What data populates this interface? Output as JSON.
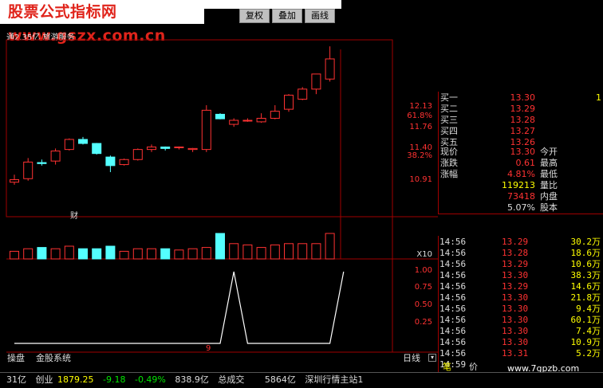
{
  "watermark": "股票公式指标网 www.gszx.com.cn",
  "toolbar": {
    "restore": "复权",
    "overlay": "叠加",
    "draw": "画线"
  },
  "stock_info": "通2.35亿 旅游服务",
  "right_axis": {
    "main": [
      "12.13",
      "61.8%",
      "11.76",
      "11.40",
      "38.2%",
      "10.91"
    ],
    "vol_label": "X10",
    "ind": [
      "1.00",
      "0.75",
      "0.50",
      "0.25"
    ]
  },
  "fin_label": "财",
  "marker_9": "9",
  "quote": {
    "bids": [
      {
        "label": "买一",
        "price": "13.30",
        "vol": "1"
      },
      {
        "label": "买二",
        "price": "13.29",
        "vol": ""
      },
      {
        "label": "买三",
        "price": "13.28",
        "vol": ""
      },
      {
        "label": "买四",
        "price": "13.27",
        "vol": ""
      },
      {
        "label": "买五",
        "price": "13.26",
        "vol": ""
      }
    ],
    "stats": [
      {
        "label": "现价",
        "value": "13.30",
        "label2": "今开"
      },
      {
        "label": "涨跌",
        "value": "0.61",
        "label2": "最高"
      },
      {
        "label": "涨幅",
        "value": "4.81%",
        "label2": "最低"
      },
      {
        "label": "",
        "value": "119213",
        "label2": "量比"
      },
      {
        "label": "",
        "value": "73418",
        "label2": "内盘"
      },
      {
        "label": "",
        "value": "5.07%",
        "label2": "股本"
      }
    ]
  },
  "ticks": [
    {
      "time": "14:56",
      "price": "13.29",
      "vol": "30.2万"
    },
    {
      "time": "14:56",
      "price": "13.28",
      "vol": "18.6万"
    },
    {
      "time": "14:56",
      "price": "13.29",
      "vol": "10.6万"
    },
    {
      "time": "14:56",
      "price": "13.30",
      "vol": "38.3万"
    },
    {
      "time": "14:56",
      "price": "13.29",
      "vol": "14.6万"
    },
    {
      "time": "14:56",
      "price": "13.30",
      "vol": "21.8万"
    },
    {
      "time": "14:56",
      "price": "13.30",
      "vol": "9.4万"
    },
    {
      "time": "14:56",
      "price": "13.30",
      "vol": "60.1万"
    },
    {
      "time": "14:56",
      "price": "13.30",
      "vol": "7.4万"
    },
    {
      "time": "14:56",
      "price": "13.30",
      "vol": "10.9万"
    },
    {
      "time": "14:56",
      "price": "13.31",
      "vol": "5.2万"
    },
    {
      "time": "14:59",
      "price": "",
      "vol": ""
    }
  ],
  "tabs": {
    "tab1": "操盘",
    "tab2": "金股系统",
    "period": "日线"
  },
  "side_tabs": {
    "a": "笔",
    "b": "价"
  },
  "bottom": {
    "a": "31亿",
    "b": "创业",
    "c": "1879.25",
    "d": "-9.18",
    "e": "-0.49%",
    "f": "838.9亿",
    "g": "总成交",
    "h": "5864亿",
    "i": "深圳行情主站1"
  },
  "site_mark": "www.7gpzb.com",
  "chart_data": {
    "type": "candlestick",
    "ohlc": [
      {
        "o": 10.85,
        "h": 11.0,
        "l": 10.8,
        "c": 10.9
      },
      {
        "o": 10.92,
        "h": 11.33,
        "l": 10.88,
        "c": 11.25
      },
      {
        "o": 11.24,
        "h": 11.3,
        "l": 11.18,
        "c": 11.22
      },
      {
        "o": 11.27,
        "h": 11.52,
        "l": 11.2,
        "c": 11.47
      },
      {
        "o": 11.5,
        "h": 11.72,
        "l": 11.48,
        "c": 11.7
      },
      {
        "o": 11.7,
        "h": 11.75,
        "l": 11.6,
        "c": 11.62
      },
      {
        "o": 11.62,
        "h": 11.63,
        "l": 11.4,
        "c": 11.42
      },
      {
        "o": 11.35,
        "h": 11.38,
        "l": 11.05,
        "c": 11.18
      },
      {
        "o": 11.2,
        "h": 11.32,
        "l": 11.18,
        "c": 11.3
      },
      {
        "o": 11.3,
        "h": 11.52,
        "l": 11.28,
        "c": 11.5
      },
      {
        "o": 11.5,
        "h": 11.6,
        "l": 11.45,
        "c": 11.55
      },
      {
        "o": 11.55,
        "h": 11.56,
        "l": 11.48,
        "c": 11.52
      },
      {
        "o": 11.54,
        "h": 11.56,
        "l": 11.5,
        "c": 11.55
      },
      {
        "o": 11.5,
        "h": 11.53,
        "l": 11.45,
        "c": 11.52
      },
      {
        "o": 11.5,
        "h": 12.38,
        "l": 11.45,
        "c": 12.28
      },
      {
        "o": 12.2,
        "h": 12.22,
        "l": 12.1,
        "c": 12.11
      },
      {
        "o": 12.0,
        "h": 12.12,
        "l": 11.95,
        "c": 12.08
      },
      {
        "o": 12.08,
        "h": 12.12,
        "l": 12.05,
        "c": 12.08
      },
      {
        "o": 12.05,
        "h": 12.22,
        "l": 12.03,
        "c": 12.12
      },
      {
        "o": 12.12,
        "h": 12.38,
        "l": 12.1,
        "c": 12.26
      },
      {
        "o": 12.3,
        "h": 12.6,
        "l": 12.25,
        "c": 12.58
      },
      {
        "o": 12.5,
        "h": 12.74,
        "l": 12.48,
        "c": 12.7
      },
      {
        "o": 12.7,
        "h": 13.0,
        "l": 12.6,
        "c": 13.0
      },
      {
        "o": 12.9,
        "h": 13.55,
        "l": 12.85,
        "c": 13.3
      }
    ],
    "volume": [
      30,
      40,
      45,
      40,
      50,
      40,
      40,
      50,
      30,
      40,
      40,
      40,
      35,
      40,
      45,
      100,
      60,
      55,
      45,
      55,
      60,
      60,
      60,
      100
    ],
    "indicator": [
      0,
      0,
      0,
      0,
      0,
      0,
      0,
      0,
      0,
      0,
      0,
      0,
      0,
      0,
      0,
      0,
      1,
      0,
      0,
      0,
      0,
      0,
      0,
      0,
      1
    ]
  }
}
